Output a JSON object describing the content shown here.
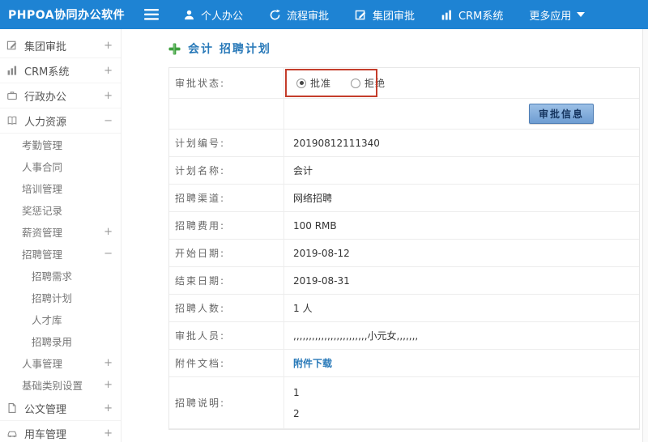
{
  "header": {
    "logo": "PHPOA协同办公软件",
    "menu_icon": "hamburger-icon",
    "nav": [
      {
        "label": "个人办公",
        "icon": "person-icon"
      },
      {
        "label": "流程审批",
        "icon": "cycle-icon"
      },
      {
        "label": "集团审批",
        "icon": "edit-square-icon"
      },
      {
        "label": "CRM系统",
        "icon": "bar-chart-icon"
      },
      {
        "label": "更多应用",
        "icon": "caret-down-icon"
      }
    ]
  },
  "sidebar": {
    "items": [
      {
        "label": "集团审批",
        "icon": "edit-square-icon",
        "toggle": "+",
        "level": 0
      },
      {
        "label": "CRM系统",
        "icon": "bar-chart-icon",
        "toggle": "+",
        "level": 0
      },
      {
        "label": "行政办公",
        "icon": "briefcase-icon",
        "toggle": "+",
        "level": 0
      },
      {
        "label": "人力资源",
        "icon": "book-icon",
        "toggle": "−",
        "level": 0
      },
      {
        "label": "考勤管理",
        "toggle": "",
        "level": 1
      },
      {
        "label": "人事合同",
        "toggle": "",
        "level": 1
      },
      {
        "label": "培训管理",
        "toggle": "",
        "level": 1
      },
      {
        "label": "奖惩记录",
        "toggle": "",
        "level": 1
      },
      {
        "label": "薪资管理",
        "toggle": "+",
        "level": 1
      },
      {
        "label": "招聘管理",
        "toggle": "−",
        "level": 1
      },
      {
        "label": "招聘需求",
        "toggle": "",
        "level": 2
      },
      {
        "label": "招聘计划",
        "toggle": "",
        "level": 2
      },
      {
        "label": "人才库",
        "toggle": "",
        "level": 2
      },
      {
        "label": "招聘录用",
        "toggle": "",
        "level": 2
      },
      {
        "label": "人事管理",
        "toggle": "+",
        "level": 1
      },
      {
        "label": "基础类别设置",
        "toggle": "+",
        "level": 1
      },
      {
        "label": "公文管理",
        "icon": "document-icon",
        "toggle": "+",
        "level": 0
      },
      {
        "label": "用车管理",
        "icon": "car-icon",
        "toggle": "+",
        "level": 0
      }
    ]
  },
  "main": {
    "title": "会计 招聘计划",
    "title_icon": "green-plus-icon",
    "status": {
      "label": "审批状态:",
      "options": [
        {
          "label": "批准",
          "checked": true
        },
        {
          "label": "拒绝",
          "checked": false
        }
      ]
    },
    "approve_button": "审批信息",
    "rows": [
      {
        "label": "计划编号:",
        "value": "20190812111340"
      },
      {
        "label": "计划名称:",
        "value": "会计"
      },
      {
        "label": "招聘渠道:",
        "value": "网络招聘"
      },
      {
        "label": "招聘费用:",
        "value": "100 RMB"
      },
      {
        "label": "开始日期:",
        "value": "2019-08-12"
      },
      {
        "label": "结束日期:",
        "value": "2019-08-31"
      },
      {
        "label": "招聘人数:",
        "value": "1 人"
      },
      {
        "label": "审批人员:",
        "value": ",,,,,,,,,,,,,,,,,,,,,,,,小元女,,,,,,,"
      },
      {
        "label": "附件文档:",
        "value": "附件下载",
        "type": "link"
      },
      {
        "label": "招聘说明:",
        "value": "1\n2"
      }
    ],
    "colors": {
      "header_blue": "#1e83d3",
      "title_blue": "#2a7ab9",
      "annotation_red": "#c43d2b",
      "link_blue": "#2a7ab9"
    }
  }
}
